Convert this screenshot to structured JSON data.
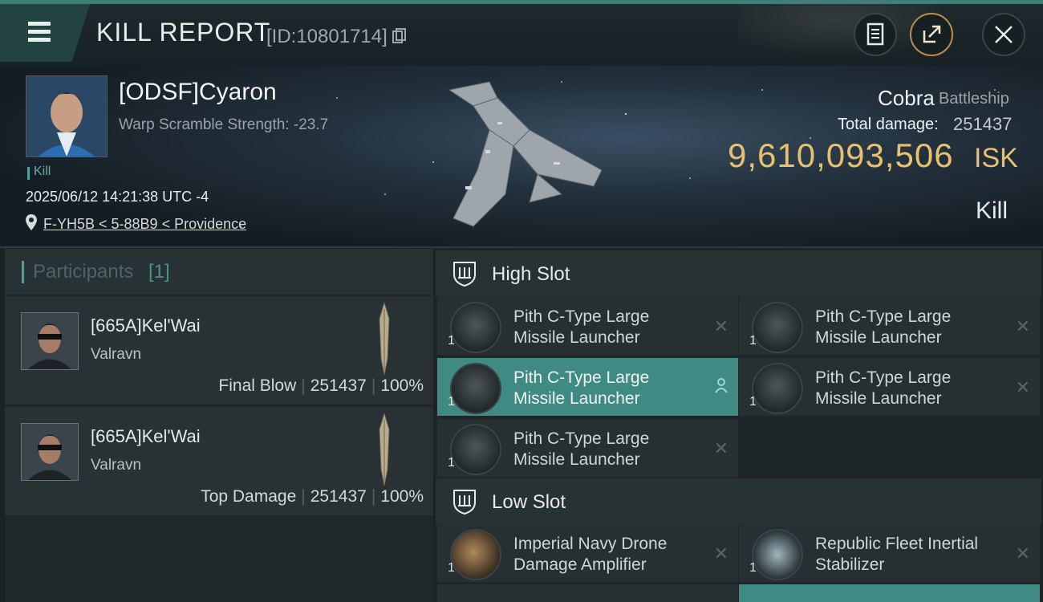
{
  "header": {
    "title": "KILL REPORT",
    "report_id": "[ID:10801714]",
    "buttons": {
      "clipboard": "clipboard-icon",
      "share": "share-icon",
      "close": "close-icon"
    }
  },
  "victim": {
    "name": "[ODSF]Cyaron",
    "warp_scramble": "Warp Scramble Strength: -23.7",
    "tag": "Kill",
    "timestamp": "2025/06/12 14:21:38 UTC -4",
    "location": "F-YH5B < 5-88B9 < Providence",
    "ship_class": "Cobra",
    "ship_type": "Battleship",
    "total_damage_label": "Total damage:",
    "total_damage": "251437",
    "isk_value": "9,610,093,506",
    "isk_unit": "ISK",
    "outcome": "Kill"
  },
  "participants": {
    "title": "Participants",
    "count": "[1]",
    "items": [
      {
        "name": "[665A]Kel'Wai",
        "ship": "Valravn",
        "role": "Final Blow",
        "damage": "251437",
        "percent": "100%"
      },
      {
        "name": "[665A]Kel'Wai",
        "ship": "Valravn",
        "role": "Top Damage",
        "damage": "251437",
        "percent": "100%"
      }
    ]
  },
  "fitting": {
    "high_slot": {
      "label": "High Slot",
      "modules": [
        {
          "line1": "Pith C-Type Large",
          "line2": "Missile Launcher",
          "qty": "1"
        },
        {
          "line1": "Pith C-Type Large",
          "line2": "Missile Launcher",
          "qty": "1"
        },
        {
          "line1": "Pith C-Type Large",
          "line2": "Missile Launcher",
          "qty": "1"
        },
        {
          "line1": "Pith C-Type Large",
          "line2": "Missile Launcher",
          "qty": "1"
        },
        {
          "line1": "Pith C-Type Large",
          "line2": "Missile Launcher",
          "qty": "1"
        }
      ]
    },
    "low_slot": {
      "label": "Low Slot",
      "modules": [
        {
          "line1": "Imperial Navy Drone",
          "line2": "Damage Amplifier",
          "qty": "1"
        },
        {
          "line1": "Republic Fleet Inertial",
          "line2": "Stabilizer",
          "qty": "1"
        }
      ]
    }
  },
  "colors": {
    "accent": "#3f8a83",
    "isk": "#e8c16e"
  }
}
